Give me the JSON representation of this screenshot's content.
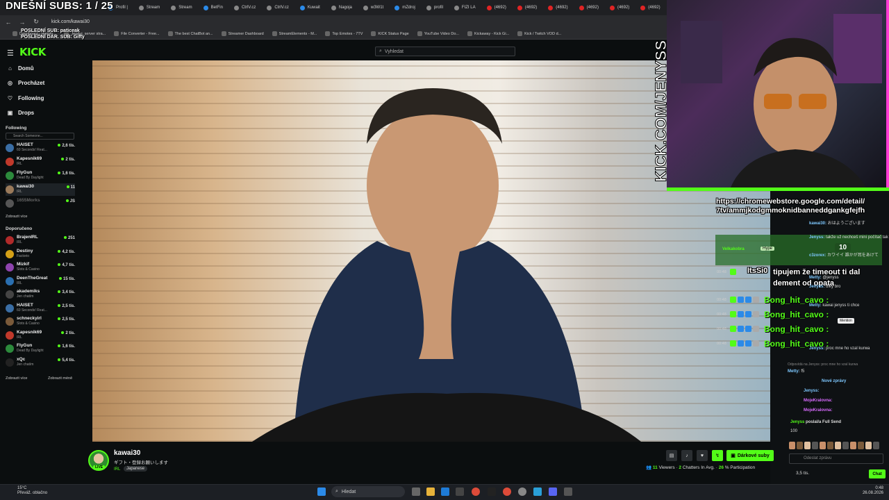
{
  "overlay": {
    "subs_counter": "DNEŠNÍ SUBS: 1 / 25",
    "last_sub": "POSLEDNÍ SUB: paticeak",
    "last_gift": "POSLEDNÍ DAR. SUB: Gifty",
    "cam_text": "KICK.COM/JENYSS"
  },
  "browser": {
    "url": "kick.com/kawai30",
    "tabs": [
      "Profil |",
      "Stream",
      "Stream",
      "BetFin",
      "CtrlV.cz",
      "CtrlV.cz",
      "Kuwait",
      "Nagoja",
      "w3W1t",
      "mZdroj",
      "profil",
      "FIZI LA",
      "(4692)",
      "(4692)",
      "(4692)",
      "(4692)",
      "(4692)",
      "(4692)"
    ],
    "bookmarks": [
      "Dashboard | Hostify...",
      "Jeoduj, server stra...",
      "File Converter - Free...",
      "The best ChatBot an...",
      "Streamer Dashboard",
      "StreamElements - M...",
      "Top Emotes - 7TV",
      "KICK Status Page",
      "YouTube Video Do...",
      "Kickaway - Kick Gi...",
      "Kick / Twitch VOD d..."
    ]
  },
  "kick": {
    "logo": "KICK",
    "search_placeholder": "Vyhledat"
  },
  "sidebar": {
    "nav": [
      {
        "label": "Domů",
        "icon": "home-icon"
      },
      {
        "label": "Procházet",
        "icon": "compass-icon"
      },
      {
        "label": "Following",
        "icon": "heart-icon"
      },
      {
        "label": "Drops",
        "icon": "gift-icon"
      }
    ],
    "following_title": "Following",
    "following_search": "Search Someone...",
    "following": [
      {
        "name": "HAISET",
        "category": "60 Seconds! Reat...",
        "viewers": "2,6 tis.",
        "color": "#3a6ea5"
      },
      {
        "name": "Kapesnik69",
        "category": "IRL",
        "viewers": "2 tis.",
        "color": "#c0392b"
      },
      {
        "name": "FlyGun",
        "category": "Dead By Daylight",
        "viewers": "1,6 tis.",
        "color": "#2c8a3c"
      },
      {
        "name": "kawai30",
        "category": "IRL",
        "viewers": "11",
        "color": "#9a7a5a"
      },
      {
        "name": "1655Morks",
        "category": "",
        "viewers": "JS",
        "color": "#555555"
      }
    ],
    "show_more": "Zobrazit více",
    "recommended_title": "Doporučeno",
    "recommended": [
      {
        "name": "BrajenIRL",
        "category": "IRL",
        "viewers": "251",
        "color": "#b02a2a"
      },
      {
        "name": "Destiny",
        "category": "Factorio",
        "viewers": "4,2 tis.",
        "color": "#d4a017"
      },
      {
        "name": "Mizkif",
        "category": "Slots & Casino",
        "viewers": "4,7 tis.",
        "color": "#8e44ad"
      },
      {
        "name": "DeenTheGreat",
        "category": "IRL",
        "viewers": "15 tis.",
        "color": "#2a6fb0"
      },
      {
        "name": "akademiks",
        "category": "Jen chatím",
        "viewers": "3,4 tis.",
        "color": "#444444"
      },
      {
        "name": "HAISET",
        "category": "60 Seconds! Reat...",
        "viewers": "2,5 tis.",
        "color": "#3a6ea5"
      },
      {
        "name": "schneckyirl",
        "category": "Slots & Casino",
        "viewers": "2,5 tis.",
        "color": "#7a5a3a"
      },
      {
        "name": "Kapesnik69",
        "category": "IRL",
        "viewers": "2 tis.",
        "color": "#c0392b"
      },
      {
        "name": "FlyGun",
        "category": "Dead By Daylight",
        "viewers": "1,6 tis.",
        "color": "#2c8a3c"
      },
      {
        "name": "xQc",
        "category": "Jen chatím",
        "viewers": "5,4 tis.",
        "color": "#222222"
      }
    ],
    "show_more_2": "Zobrazit více",
    "show_less": "Zobrazit méně"
  },
  "stream": {
    "channel": "kawai30",
    "title": "ギフト・登録お願いします",
    "category": "IRL",
    "tag": "Japanese",
    "live": "LIVE",
    "gift_button": "Dárkové suby",
    "viewers_value": "11",
    "viewers_label": "Viewers",
    "chatters_value": "2",
    "chatters_label": "Chatters In Avg.",
    "participation_value": "26",
    "participation_label": "% Participation"
  },
  "chat_overlay": {
    "link": "https://chromewebstore.google.com/detail/7tv/ammjkodgmmoknidbanneddgankgfejfh",
    "hype_user": "Velkakobra",
    "hype_label": "Hype",
    "hype_count": "10",
    "msg_time": "00:48",
    "msg_user": "ItsSi0",
    "msg_text": "tipujem že timeout ti dal dement od opata",
    "bong_user": "Bong_hit_cavo :",
    "bong_times": [
      "00:48",
      "00:48",
      "00:48",
      "00:48"
    ]
  },
  "chat": {
    "lines": [
      {
        "user": "kawai30:",
        "text": "おはようございます"
      },
      {
        "user": "Jenyss:",
        "text": "takže už nechceš mini počítač tak"
      },
      {
        "user": "c3zorex:",
        "text": "カワイイ 誰かが耳をあけて"
      },
      {
        "user": "Metty:",
        "text": "@jenyss"
      },
      {
        "user": "Jenyss:",
        "text": "díky bro"
      },
      {
        "user": "Metty:",
        "text": "kawai jenyss ti chce"
      },
      {
        "user": "Jenyss:",
        "text": "proc mne ho vzal kurwa"
      }
    ],
    "reply_hint": "Odpovídá na Jenyss: proc mne ho vzal kurwa",
    "reply_user": "Metty:",
    "reply_text": "f5",
    "new_messages": "Nové zprávy",
    "new_lines": [
      {
        "user": "Jenyss:",
        "text": ""
      },
      {
        "user": "MojeKralovna:",
        "text": ""
      },
      {
        "user": "MojeKralovna:",
        "text": ""
      }
    ],
    "mention": "Mention",
    "send_user": "Jenyss",
    "send_text": "poslal/a Full Send",
    "send_amount": "100",
    "input_placeholder": "Odeslat zprávu",
    "points": "3,5 tis.",
    "chat_button": "Chat"
  },
  "taskbar": {
    "temp": "15°C",
    "weather": "Převáž. oblačno",
    "search": "Hledat",
    "time": "0:48",
    "date": "26.08.2026"
  }
}
